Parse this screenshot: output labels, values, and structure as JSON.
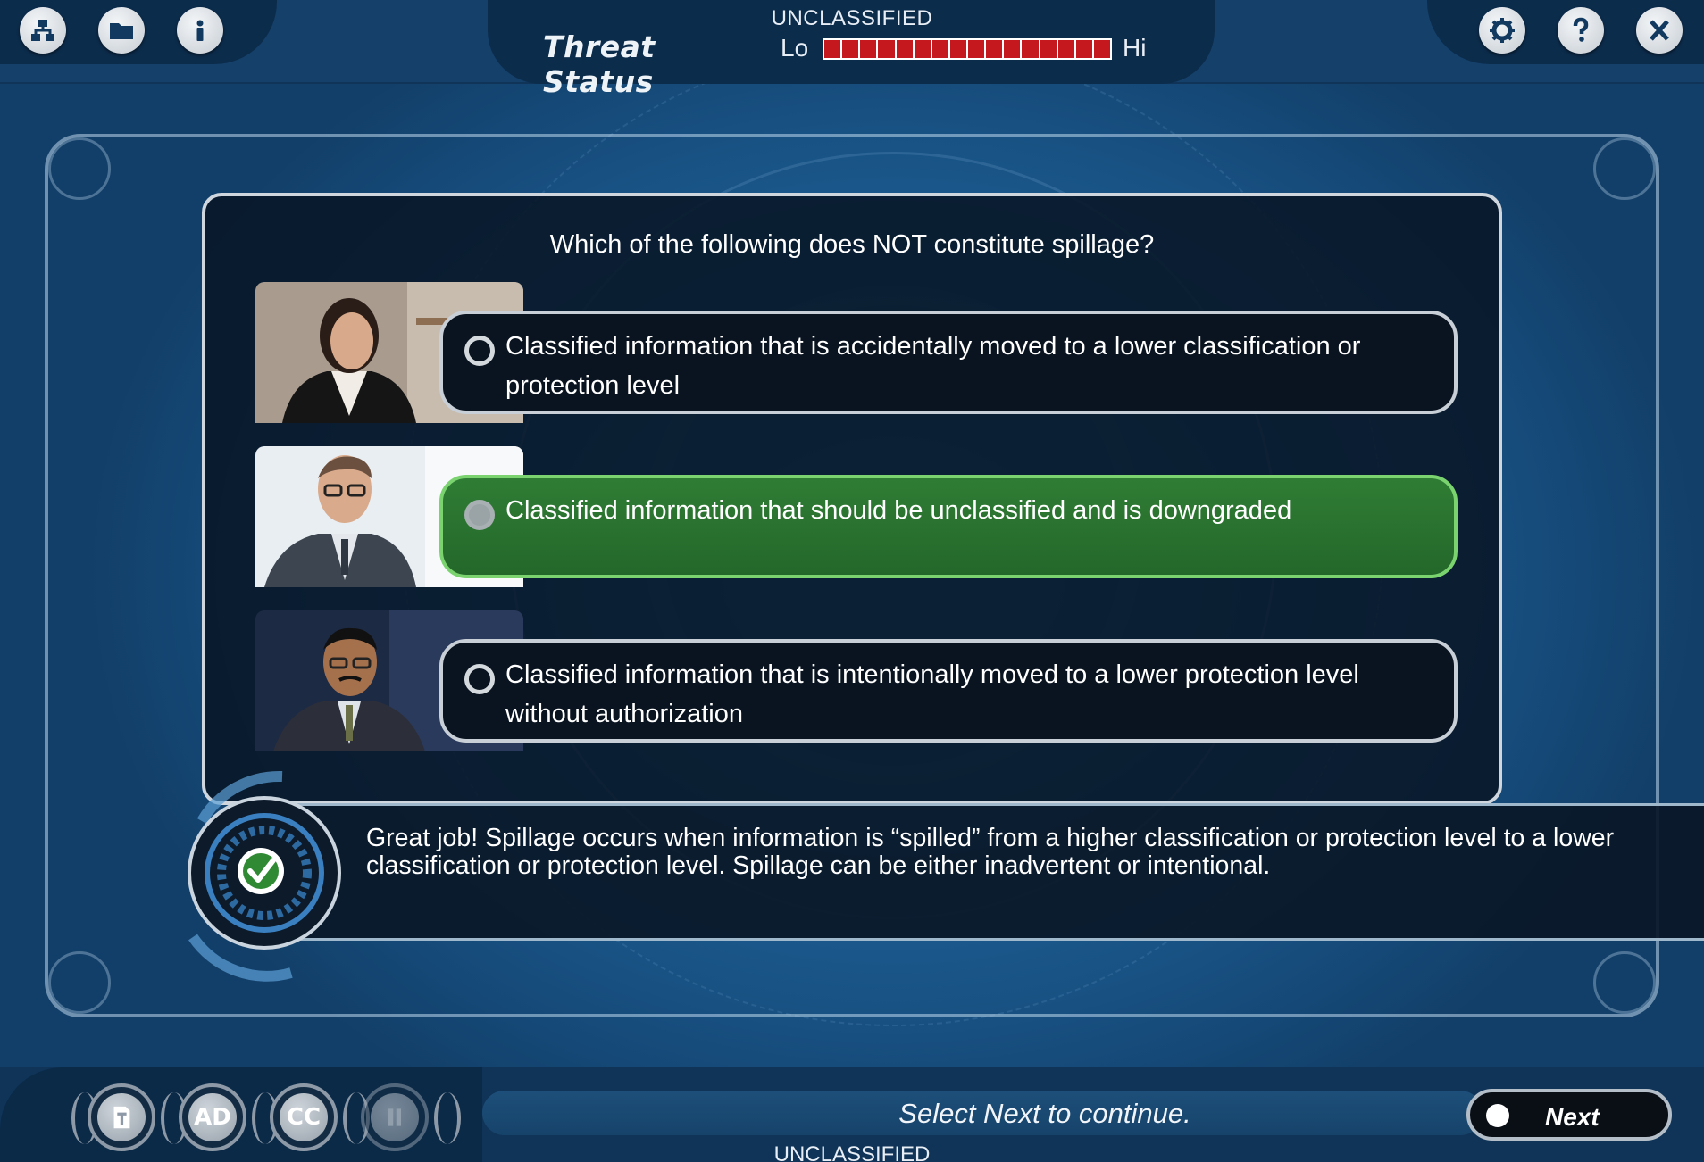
{
  "header": {
    "classification": "UNCLASSIFIED",
    "threat_title": "Threat Status",
    "threat_lo": "Lo",
    "threat_hi": "Hi",
    "threat_level": 1.0,
    "threat_color": "#c4171e",
    "left_icons": [
      "sitemap-icon",
      "folder-icon",
      "info-icon"
    ],
    "right_icons": [
      "gear-icon",
      "help-icon",
      "close-icon"
    ]
  },
  "question": {
    "prompt": "Which of the following does NOT constitute spillage?",
    "options": [
      {
        "text": "Classified information that is accidentally moved to a lower classification or protection level",
        "state": "unselected"
      },
      {
        "text": "Classified information that should be unclassified and is downgraded",
        "state": "correct-selected"
      },
      {
        "text": "Classified information that is intentionally moved to a lower protection level without authorization",
        "state": "unselected"
      }
    ]
  },
  "feedback": {
    "text": "Great job! Spillage occurs when information is “spilled” from a higher classification or protection level to a lower classification or protection level. Spillage can be either inadvertent or intentional.",
    "icon": "check-icon",
    "color": "#2f7d34"
  },
  "footer": {
    "controls": [
      {
        "label": "",
        "icon": "transcript-icon"
      },
      {
        "label": "AD"
      },
      {
        "label": "CC"
      },
      {
        "label": "",
        "icon": "pause-icon"
      }
    ],
    "status": "Select Next to continue.",
    "next_label": "Next",
    "classification": "UNCLASSIFIED"
  }
}
